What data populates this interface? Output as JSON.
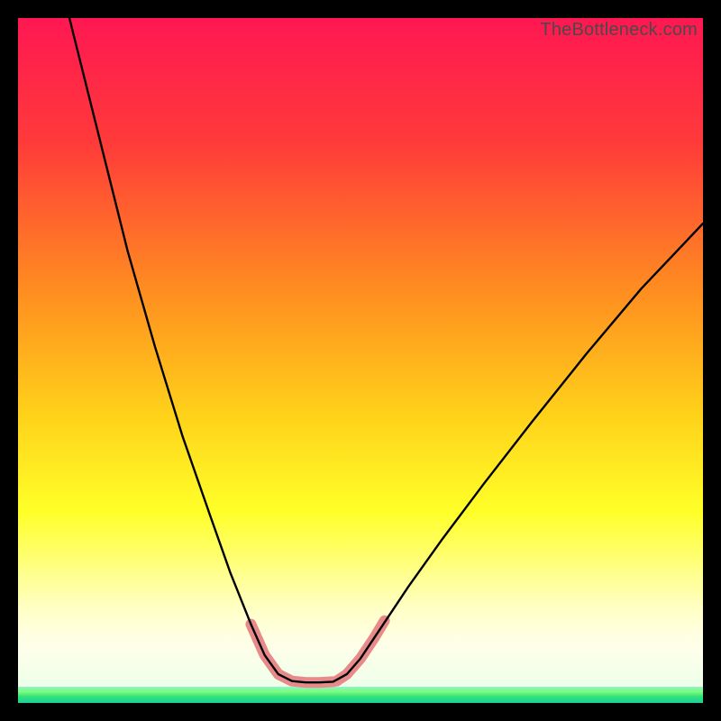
{
  "watermark": {
    "text": "TheBottleneck.com"
  },
  "chart_data": {
    "type": "line",
    "title": "",
    "xlabel": "",
    "ylabel": "",
    "xlim": [
      0,
      100
    ],
    "ylim": [
      0,
      100
    ],
    "grid": false,
    "legend": false,
    "background_gradient": {
      "stops": [
        {
          "pos": 0.0,
          "color": "#ff1752"
        },
        {
          "pos": 0.18,
          "color": "#ff3a3a"
        },
        {
          "pos": 0.4,
          "color": "#ff8e20"
        },
        {
          "pos": 0.58,
          "color": "#ffd21a"
        },
        {
          "pos": 0.72,
          "color": "#ffff28"
        },
        {
          "pos": 0.82,
          "color": "#ffff94"
        },
        {
          "pos": 0.9,
          "color": "#ffffe6"
        },
        {
          "pos": 0.965,
          "color": "#d9ffe0"
        },
        {
          "pos": 1.0,
          "color": "#1ad8a0"
        }
      ]
    },
    "series": [
      {
        "name": "bottleneck-curve",
        "stroke": "#000000",
        "points": [
          {
            "x": 7.5,
            "y": 100.0
          },
          {
            "x": 9.0,
            "y": 94.0
          },
          {
            "x": 12.0,
            "y": 82.0
          },
          {
            "x": 16.0,
            "y": 66.0
          },
          {
            "x": 20.0,
            "y": 52.0
          },
          {
            "x": 24.0,
            "y": 39.0
          },
          {
            "x": 28.0,
            "y": 27.5
          },
          {
            "x": 31.0,
            "y": 19.0
          },
          {
            "x": 34.0,
            "y": 11.5
          },
          {
            "x": 36.0,
            "y": 7.0
          },
          {
            "x": 38.0,
            "y": 4.2
          },
          {
            "x": 40.0,
            "y": 3.2
          },
          {
            "x": 42.0,
            "y": 3.0
          },
          {
            "x": 44.0,
            "y": 3.0
          },
          {
            "x": 46.0,
            "y": 3.1
          },
          {
            "x": 48.0,
            "y": 4.2
          },
          {
            "x": 50.0,
            "y": 6.5
          },
          {
            "x": 53.0,
            "y": 11.0
          },
          {
            "x": 57.0,
            "y": 17.0
          },
          {
            "x": 62.0,
            "y": 24.0
          },
          {
            "x": 68.0,
            "y": 32.0
          },
          {
            "x": 75.0,
            "y": 41.0
          },
          {
            "x": 83.0,
            "y": 51.0
          },
          {
            "x": 91.0,
            "y": 60.5
          },
          {
            "x": 100.0,
            "y": 70.0
          }
        ]
      },
      {
        "name": "highlight-segment-left",
        "stroke": "#e88a8a",
        "stroke_width": 10,
        "points": [
          {
            "x": 34.0,
            "y": 11.5
          },
          {
            "x": 36.0,
            "y": 7.0
          },
          {
            "x": 38.0,
            "y": 4.2
          },
          {
            "x": 40.0,
            "y": 3.2
          },
          {
            "x": 42.0,
            "y": 3.0
          },
          {
            "x": 44.0,
            "y": 3.0
          },
          {
            "x": 46.0,
            "y": 3.1
          }
        ]
      },
      {
        "name": "highlight-segment-right",
        "stroke": "#e88a8a",
        "stroke_width": 10,
        "points": [
          {
            "x": 46.5,
            "y": 3.2
          },
          {
            "x": 48.0,
            "y": 4.2
          },
          {
            "x": 50.0,
            "y": 6.5
          },
          {
            "x": 52.0,
            "y": 9.5
          },
          {
            "x": 53.5,
            "y": 12.0
          }
        ]
      }
    ]
  }
}
